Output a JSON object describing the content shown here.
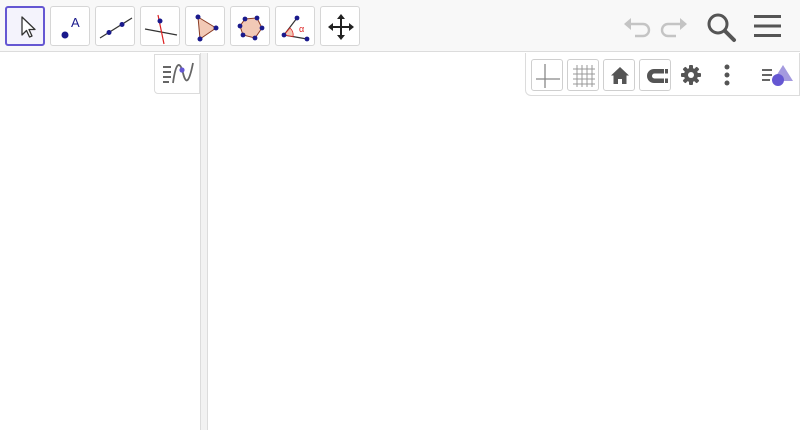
{
  "app": {
    "accent_color": "#6557d2",
    "point_color": "#1a1a8c",
    "polygon_fill": "#f2c9b6"
  },
  "toolbar": {
    "tools": [
      {
        "name": "move-tool",
        "icon": "arrow-cursor-icon",
        "selected": true
      },
      {
        "name": "point-tool",
        "icon": "point-with-label-icon",
        "label": "A"
      },
      {
        "name": "line-tool",
        "icon": "line-through-points-icon"
      },
      {
        "name": "perpendicular-line-tool",
        "icon": "perpendicular-line-icon"
      },
      {
        "name": "polygon-tool",
        "icon": "triangle-polygon-icon"
      },
      {
        "name": "circle-tool",
        "icon": "circle-through-points-icon"
      },
      {
        "name": "angle-tool",
        "icon": "angle-icon",
        "label": "α"
      },
      {
        "name": "move-graphics-tool",
        "icon": "move-arrows-icon"
      }
    ],
    "right_actions": [
      "undo-icon",
      "redo-icon",
      "search-icon",
      "menu-icon"
    ]
  },
  "algebra": {
    "toggle_icon": "algebra-view-toggle-icon"
  },
  "graphics_style_bar": {
    "buttons": [
      "axes-icon",
      "grid-icon",
      "home-icon",
      "point-capture-icon",
      "settings-gear-icon",
      "more-vertical-icon",
      "style-bar-toggle-icon"
    ]
  }
}
